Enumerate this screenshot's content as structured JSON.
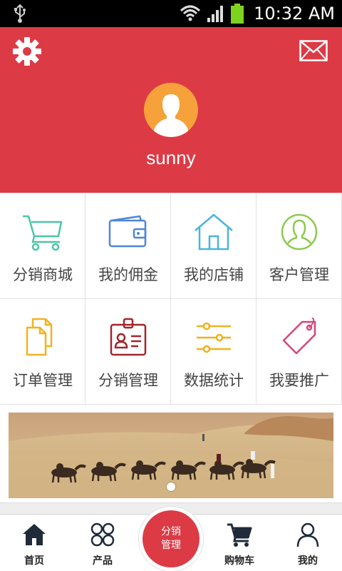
{
  "status_bar": {
    "time": "10:32 AM",
    "icons": [
      "usb-icon",
      "wifi-icon",
      "signal-icon",
      "battery-icon"
    ]
  },
  "header": {
    "background_color": "#dc3b46",
    "icons": [
      "settings-gear-icon",
      "mail-icon",
      "avatar-icon"
    ],
    "username": "sunny"
  },
  "grid": {
    "items": [
      {
        "label": "分销商城",
        "icon": "shopping-cart-icon",
        "color": "#4cc6a6"
      },
      {
        "label": "我的佣金",
        "icon": "wallet-icon",
        "color": "#4e86d8"
      },
      {
        "label": "我的店铺",
        "icon": "house-icon",
        "color": "#4cb4d8"
      },
      {
        "label": "客户管理",
        "icon": "user-circle-icon",
        "color": "#8cca4e"
      },
      {
        "label": "订单管理",
        "icon": "documents-icon",
        "color": "#f1b321"
      },
      {
        "label": "分销管理",
        "icon": "id-badge-icon",
        "color": "#a1262d"
      },
      {
        "label": "数据统计",
        "icon": "sliders-icon",
        "color": "#f0b11e"
      },
      {
        "label": "我要推广",
        "icon": "price-tag-icon",
        "color": "#d6457a"
      }
    ]
  },
  "banner": {
    "description_icon": "camel-caravan-desert-image",
    "indicator_count": 1,
    "active_index": 0
  },
  "bottom_nav": {
    "items": [
      {
        "label": "首页",
        "icon": "home-icon"
      },
      {
        "label": "产品",
        "icon": "four-circles-grid-icon"
      },
      {
        "label": "分销管理",
        "icon": "center-action-button"
      },
      {
        "label": "购物车",
        "icon": "shopping-cart-icon"
      },
      {
        "label": "我的",
        "icon": "person-icon"
      }
    ],
    "center_label_line1": "分销",
    "center_label_line2": "管理",
    "accent_color": "#dc3b46"
  }
}
